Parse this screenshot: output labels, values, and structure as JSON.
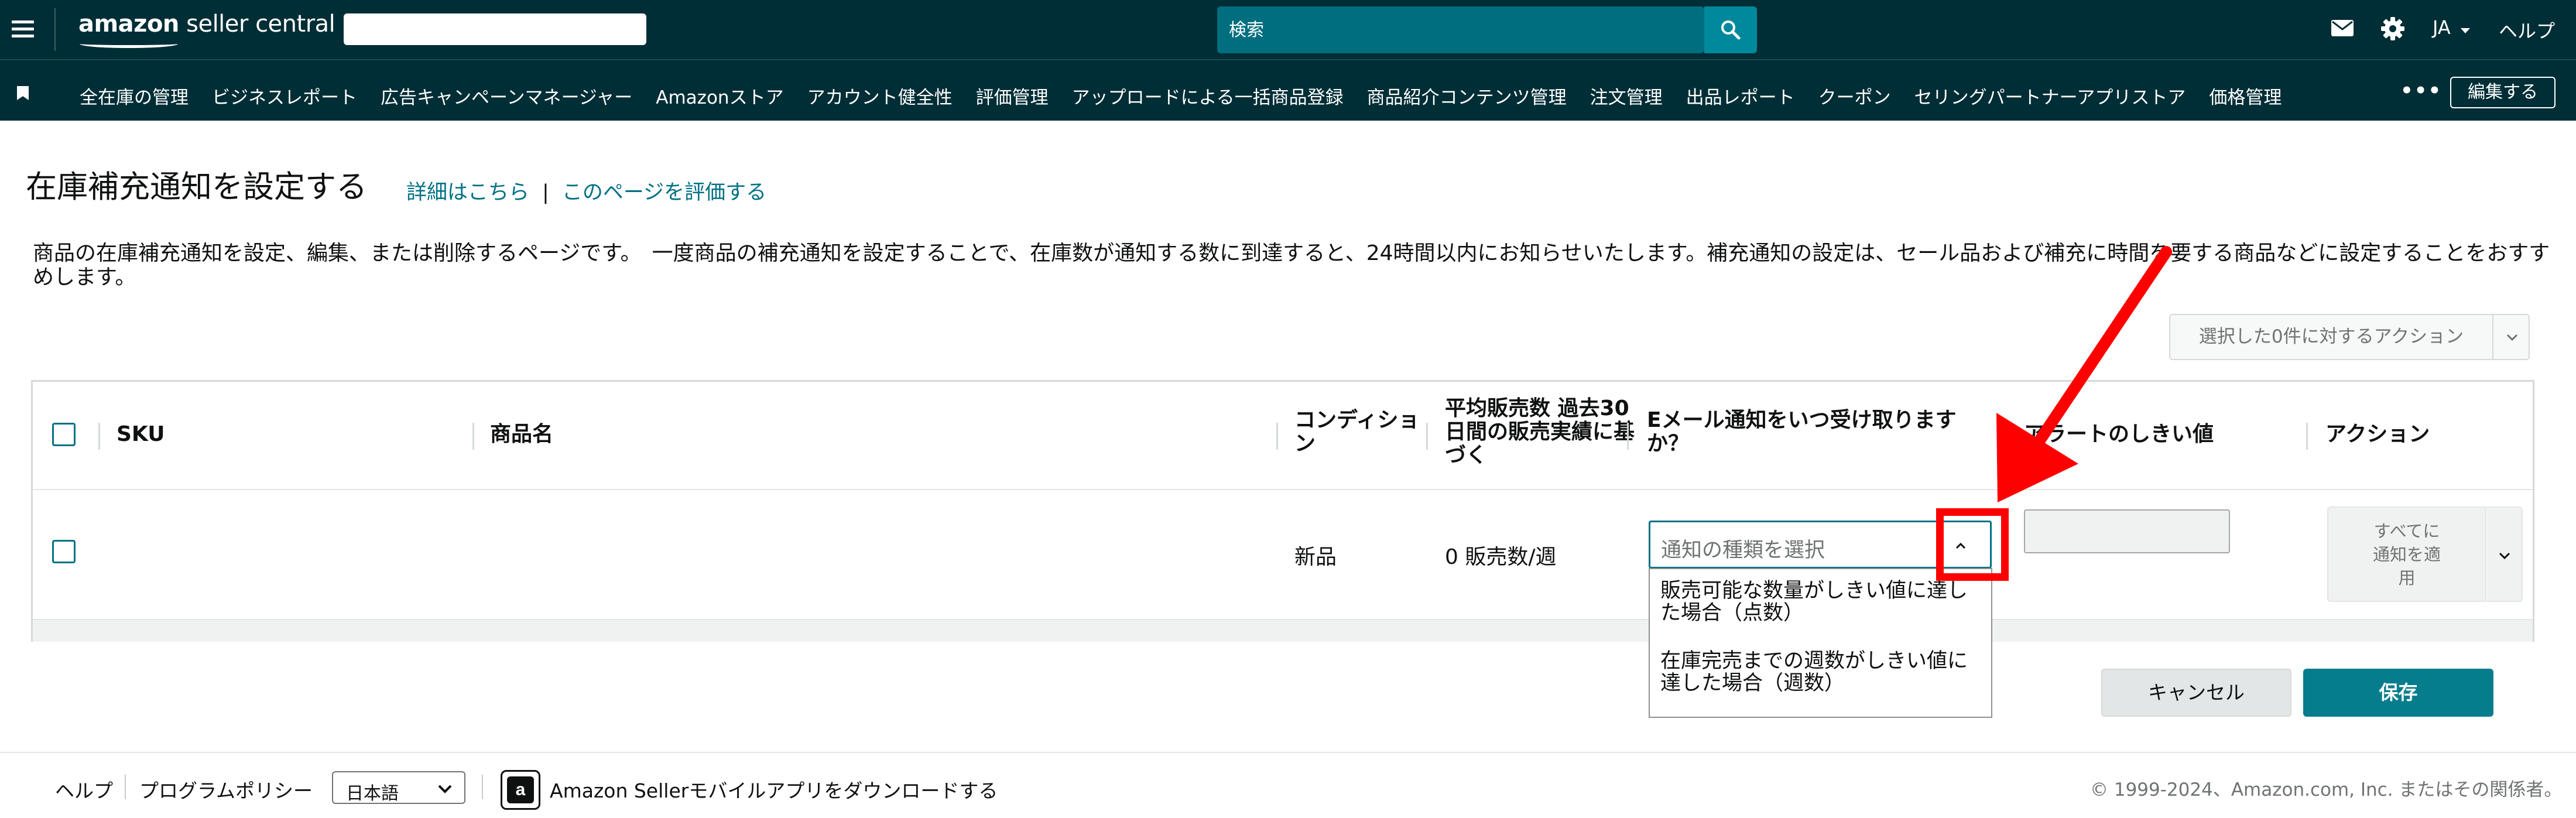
{
  "app": {
    "brand_bold": "amazon",
    "brand_rest": " seller central"
  },
  "header": {
    "search_placeholder": "検索",
    "language": "JA",
    "help": "ヘルプ",
    "icons": [
      "menu-icon",
      "mail-icon",
      "gear-icon",
      "search-icon"
    ]
  },
  "nav": {
    "items": [
      "全在庫の管理",
      "ビジネスレポート",
      "広告キャンペーンマネージャー",
      "Amazonストア",
      "アカウント健全性",
      "評価管理",
      "アップロードによる一括商品登録",
      "商品紹介コンテンツ管理",
      "注文管理",
      "出品レポート",
      "クーポン",
      "セリングパートナーアプリストア",
      "価格管理"
    ],
    "more": "•••",
    "edit": "編集する"
  },
  "page": {
    "title": "在庫補充通知を設定する",
    "link_learn": "詳細はこちら",
    "link_separator": "|",
    "link_rate": "このページを評価する",
    "description": "商品の在庫補充通知を設定、編集、または削除するページです。　一度商品の補充通知を設定することで、在庫数が通知する数に到達すると、24時間以内にお知らせいたします。補充通知の設定は、セール品および補充に時間を要する商品などに設定することをおすすめします。",
    "bulk_action": "選択した0件に対するアクション"
  },
  "table": {
    "headers": {
      "sku": "SKU",
      "product_name": "商品名",
      "condition": "コンディション",
      "avg_sales": "平均販売数 過去30日間の販売実績に基づく",
      "email_when": "Eメール通知をいつ受け取りますか？",
      "alert_threshold": "アラートのしきい値",
      "action": "アクション"
    },
    "rows": [
      {
        "sku": "",
        "product_name": "",
        "condition": "新品",
        "avg_sales": "0 販売数/週",
        "notification_placeholder": "通知の種類を選択",
        "threshold": "",
        "action_label": "すべてに通知を適用"
      }
    ],
    "notification_options": [
      "販売可能な数量がしきい値に達した場合（点数）",
      "在庫完売までの週数がしきい値に達した場合（週数）"
    ]
  },
  "buttons": {
    "cancel": "キャンセル",
    "save": "保存"
  },
  "footer": {
    "help": "ヘルプ",
    "policy": "プログラムポリシー",
    "language": "日本語",
    "app_icon_letter": "a",
    "app_download": "Amazon Sellerモバイルアプリをダウンロードする",
    "copyright": "© 1999-2024、Amazon.com, Inc. またはその関係者。"
  },
  "annotation": {
    "color": "#ff0000"
  },
  "colors": {
    "header_bg": "#002e36",
    "search_bg": "#006e7f",
    "link": "#007185",
    "save_bg": "#067d8d"
  }
}
